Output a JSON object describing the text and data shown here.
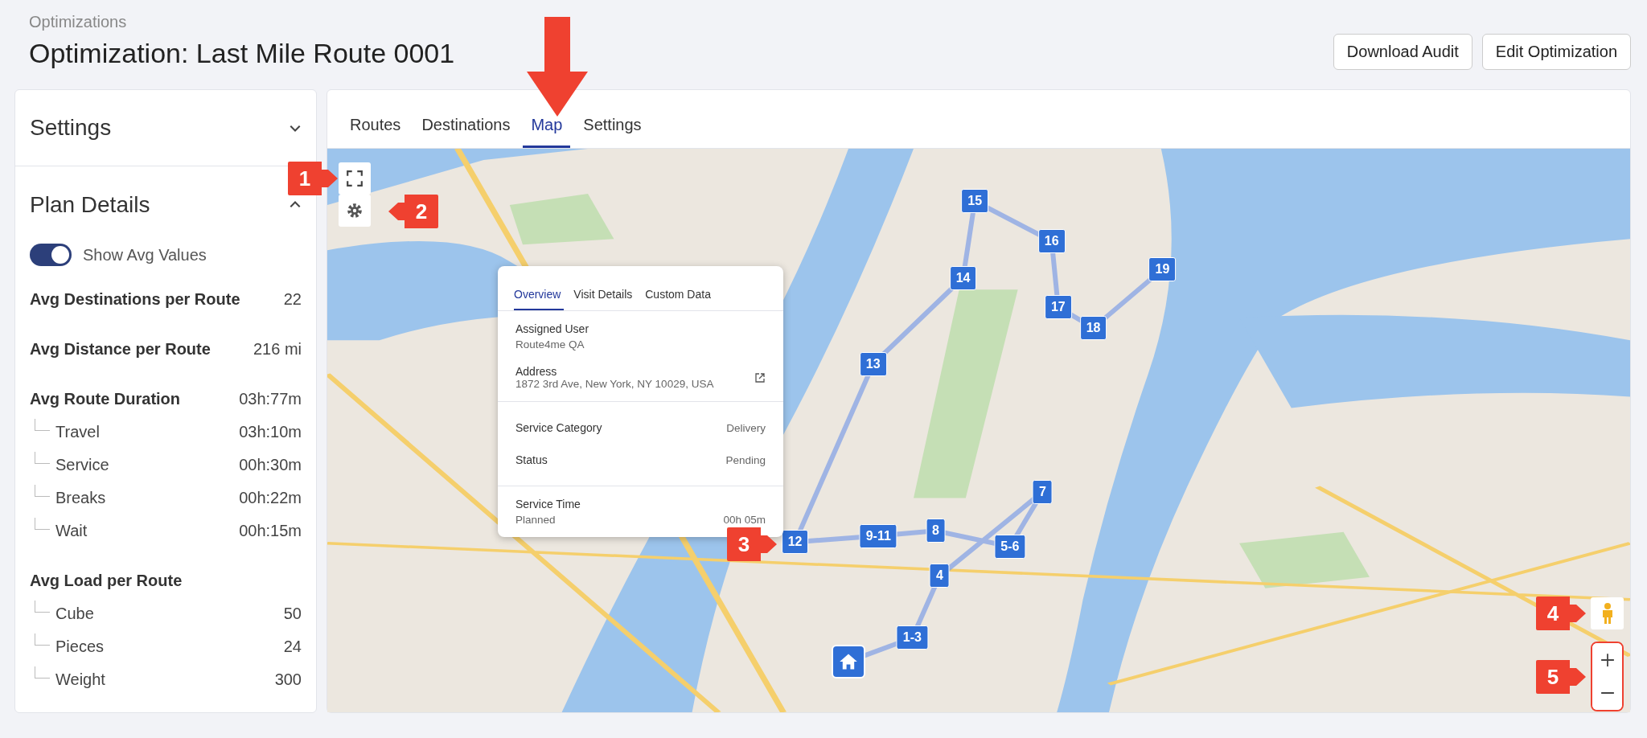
{
  "breadcrumb": "Optimizations",
  "title": "Optimization: Last Mile Route 0001",
  "header_buttons": [
    "Download Audit",
    "Edit Optimization"
  ],
  "sidebar": {
    "settings": {
      "title": "Settings",
      "expanded": false
    },
    "plan_details": {
      "title": "Plan Details",
      "expanded": true,
      "toggle": {
        "label": "Show Avg Values",
        "on": true
      },
      "rows": [
        {
          "label": "Avg Destinations per Route",
          "value": "22"
        },
        {
          "label": "Avg Distance per Route",
          "value": "216 mi"
        },
        {
          "label": "Avg Route Duration",
          "value": "03h:77m",
          "children": [
            {
              "label": "Travel",
              "value": "03h:10m"
            },
            {
              "label": "Service",
              "value": "00h:30m"
            },
            {
              "label": "Breaks",
              "value": "00h:22m"
            },
            {
              "label": "Wait",
              "value": "00h:15m"
            }
          ]
        },
        {
          "label": "Avg Load per Route",
          "value": "",
          "children": [
            {
              "label": "Cube",
              "value": "50"
            },
            {
              "label": "Pieces",
              "value": "24"
            },
            {
              "label": "Weight",
              "value": "300"
            }
          ]
        }
      ]
    }
  },
  "tabs": [
    {
      "label": "Routes",
      "selected": false
    },
    {
      "label": "Destinations",
      "selected": false
    },
    {
      "label": "Map",
      "selected": true
    },
    {
      "label": "Settings",
      "selected": false
    }
  ],
  "map": {
    "markers": [
      "15",
      "16",
      "19",
      "14",
      "17",
      "18",
      "13",
      "7",
      "8",
      "9-11",
      "12",
      "5-6",
      "4",
      "1-3"
    ],
    "popup": {
      "tabs": [
        {
          "label": "Overview",
          "selected": true
        },
        {
          "label": "Visit Details",
          "selected": false
        },
        {
          "label": "Custom Data",
          "selected": false
        }
      ],
      "assigned_user": {
        "label": "Assigned User",
        "value": "Route4me QA"
      },
      "address": {
        "label": "Address",
        "value": "1872 3rd Ave, New York, NY 10029, USA"
      },
      "rows": [
        {
          "label": "Service Category",
          "value": "Delivery"
        },
        {
          "label": "Status",
          "value": "Pending"
        }
      ],
      "service_time": {
        "label": "Service Time",
        "sublabel": "Planned",
        "value": "00h 05m"
      }
    },
    "callouts": [
      "1",
      "2",
      "3",
      "4",
      "5"
    ]
  }
}
